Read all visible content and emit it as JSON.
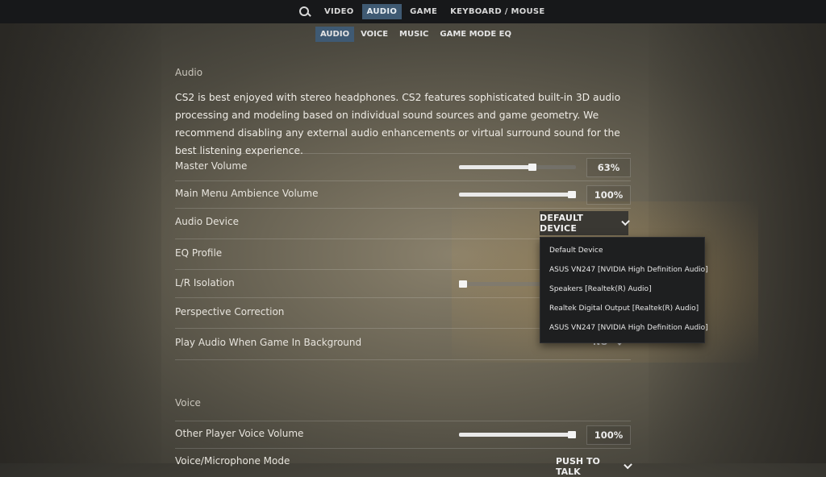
{
  "nav": {
    "tabs": [
      {
        "label": "VIDEO"
      },
      {
        "label": "AUDIO",
        "active": true
      },
      {
        "label": "GAME"
      },
      {
        "label": "KEYBOARD / MOUSE"
      }
    ],
    "search_icon": "search-icon"
  },
  "subnav": {
    "tabs": [
      {
        "label": "AUDIO",
        "active": true
      },
      {
        "label": "VOICE"
      },
      {
        "label": "MUSIC"
      },
      {
        "label": "GAME MODE EQ"
      }
    ]
  },
  "audio": {
    "section_title": "Audio",
    "description": "CS2 is best enjoyed with stereo headphones. CS2 features sophisticated built-in 3D audio processing and modeling based on individual sound sources and game geometry. We recommend disabling any external audio enhancements or virtual surround sound for the best listening experience.",
    "master_volume": {
      "label": "Master Volume",
      "value": "63%",
      "level": 0.63
    },
    "menu_ambience": {
      "label": "Main Menu Ambience Volume",
      "value": "100%",
      "level": 1.0
    },
    "audio_device": {
      "label": "Audio Device",
      "selected": "DEFAULT DEVICE",
      "options": [
        "Default Device",
        "ASUS VN247 [NVIDIA High Definition Audio]",
        "Speakers [Realtek(R) Audio]",
        "Realtek Digital Output [Realtek(R) Audio]",
        "ASUS VN247 [NVIDIA High Definition Audio]"
      ]
    },
    "eq_profile": {
      "label": "EQ Profile"
    },
    "lr_isolation": {
      "label": "L/R Isolation",
      "level": 0.0
    },
    "perspective": {
      "label": "Perspective Correction"
    },
    "background_audio": {
      "label": "Play Audio When Game In Background",
      "value": "NO"
    }
  },
  "voice": {
    "section_title": "Voice",
    "other_volume": {
      "label": "Other Player Voice Volume",
      "value": "100%",
      "level": 1.0
    },
    "mic_mode": {
      "label": "Voice/Microphone Mode",
      "value": "PUSH TO TALK"
    }
  },
  "colors": {
    "accent": "#3f5a73",
    "topbar": "#17181a",
    "dropdown_bg": "#1e1f20"
  }
}
